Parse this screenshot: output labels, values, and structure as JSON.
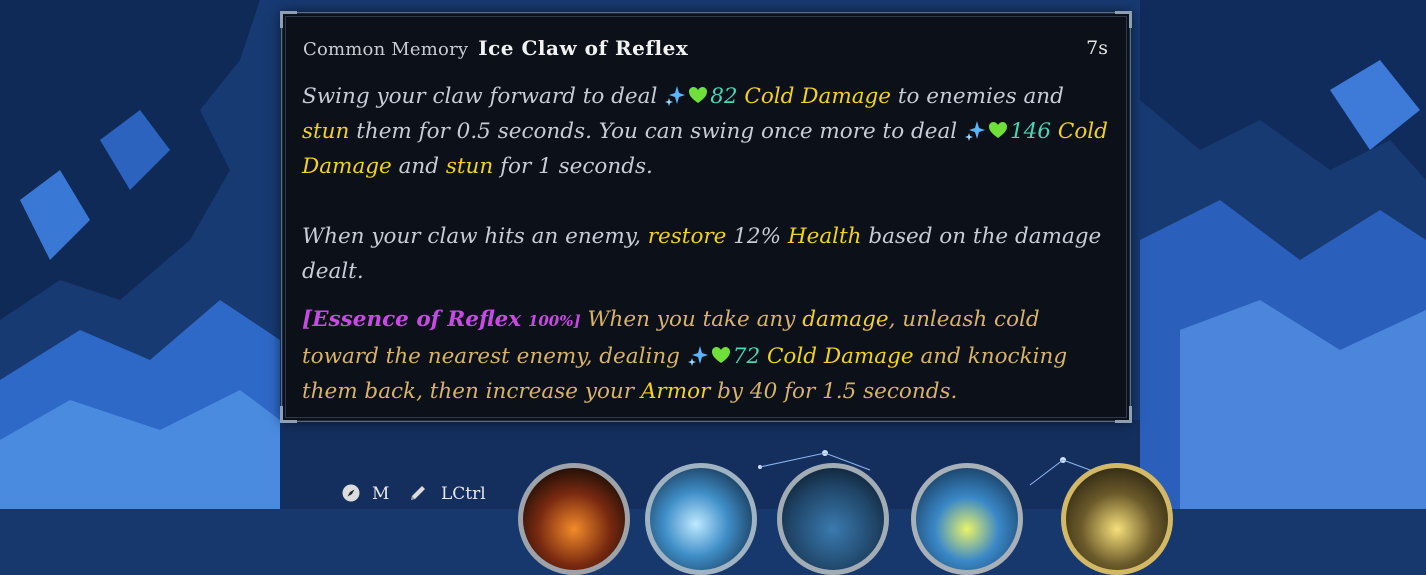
{
  "tooltip": {
    "rarity": "Common Memory",
    "title": "Ice Claw of Reflex",
    "cooldown": "7s",
    "p1": {
      "t1": "Swing your claw forward to deal",
      "n1": "82",
      "cold1": "Cold Damage",
      "t2": "to enemies and",
      "stun1": "stun",
      "t3": "them for 0.5 seconds. You can swing once more to deal",
      "n2": "146",
      "cold2": "Cold Damage",
      "t4": "and",
      "stun2": "stun",
      "t5": "for 1 seconds."
    },
    "p2": {
      "t1": "When your claw hits an enemy,",
      "restore": "restore",
      "pct": "12%",
      "health": "Health",
      "t2": "based on the damage dealt."
    },
    "essence": {
      "name": "[Essence of Reflex",
      "percent": "100%]",
      "t1": "When you take any",
      "damage": "damage",
      "t2": ", unleash cold toward the nearest enemy, dealing",
      "n": "72",
      "cold": "Cold Damage",
      "t3": "and knocking them back, then increase your",
      "armor": "Armor",
      "t4": "by 40 for 1.5 seconds."
    }
  },
  "hud": {
    "map_key": "M",
    "edit_key": "LCtrl",
    "map_icon": "compass-icon",
    "edit_icon": "pencil-icon"
  },
  "colors": {
    "keyword": "#f2d21a",
    "number": "#49d6b4",
    "essence": "#c948e6",
    "essence_text": "#d8b366"
  }
}
